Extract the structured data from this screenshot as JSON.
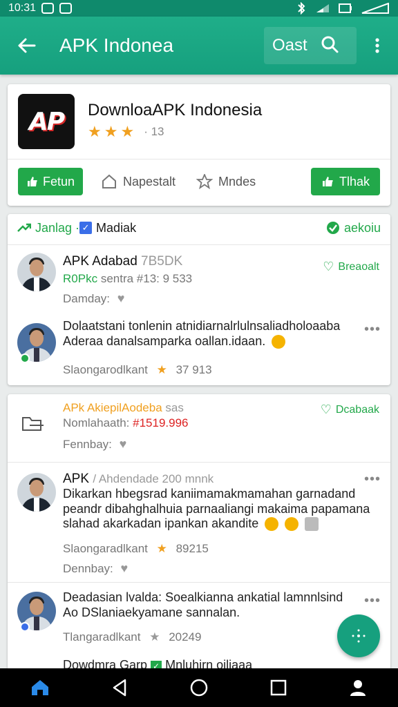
{
  "status_bar": {
    "time": "10:31"
  },
  "app_bar": {
    "title": "APK Indonea",
    "right_text": "Oast"
  },
  "app_card": {
    "logo_text": "AP",
    "name": "DownloaAPK Indonesia",
    "rating_stars": 3,
    "rating_text": "· 13",
    "actions": {
      "follow": "Fetun",
      "bookmark": "Napestalt",
      "favorite": "Mndes",
      "thank": "Tlhak"
    }
  },
  "feed_card_1": {
    "header": {
      "tag": "Janlag ·",
      "category": "Madiak",
      "right": "aekoiu"
    },
    "post": {
      "author": "APK Adabad",
      "author_meta": "7B5DK",
      "source_label": "R0Pkc",
      "source_meta": "sentra #13: 9 533",
      "date": "Damday:",
      "follow": "Breaoalt"
    },
    "comment": {
      "line1": "Dolaatstani tonlenin atnidiarnalrlulnsaliadholoaaba",
      "line2": "Aderaa danalsamparka oallan.idaan.",
      "stats_label": "Slaongarodlkant",
      "stats_value": "37 913"
    }
  },
  "feed_card_2": {
    "post": {
      "title": "APk AkiepilAodeba",
      "title_suffix": "sas",
      "subtitle_label": "Nomlahaath:",
      "subtitle_value": "#1519.996",
      "date": "Fennbay:",
      "follow": "Dcabaak"
    },
    "comment_1": {
      "author": "APK",
      "author_meta": "/ Ahdendade 200 mnnk",
      "line1": "Dikarkan hbegsrad kaniimamakmamahan garnadand",
      "line2": "peandr dibahghalhuia parnaaliangi makaima papamana",
      "line3": "slahad akarkadan ipankan akandite",
      "stats_label": "Slaongaradlkant",
      "stats_value": "89215",
      "date": "Dennbay:"
    },
    "comment_2": {
      "line1": "Deadasian lvalda: Soealkianna ankatial lamnnlsind",
      "line2": "Ao DSlaniaekyamane sannalan.",
      "stats_label": "Tlangaradlkant",
      "stats_value": "20249",
      "line4": "Dowdmra Garp",
      "line4b": "Mnluhirn oiliaaa"
    }
  },
  "colors": {
    "accent": "#16a07e",
    "green": "#22a84a",
    "star": "#f0a020"
  }
}
